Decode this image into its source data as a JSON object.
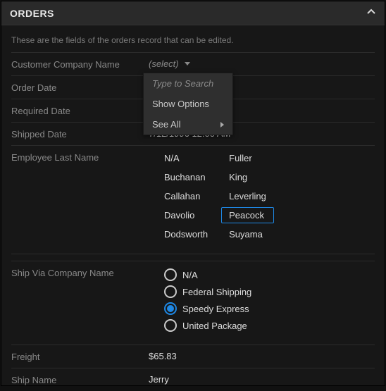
{
  "header": {
    "title": "ORDERS"
  },
  "intro": "These are the fields of the orders record that can be edited.",
  "fields": {
    "customer": {
      "label": "Customer Company Name",
      "placeholder": "(select)",
      "dropdown": {
        "hint": "Type to Search",
        "show_options": "Show Options",
        "see_all": "See All"
      }
    },
    "order_date": {
      "label": "Order Date",
      "value": ""
    },
    "required_date": {
      "label": "Required Date",
      "value": ""
    },
    "shipped_date": {
      "label": "Shipped Date",
      "value": "7/12/1996 12:00 AM"
    },
    "employee": {
      "label": "Employee Last Name",
      "col1": [
        "N/A",
        "Buchanan",
        "Callahan",
        "Davolio",
        "Dodsworth"
      ],
      "col2": [
        "Fuller",
        "King",
        "Leverling",
        "Peacock",
        "Suyama"
      ],
      "selected": "Peacock"
    },
    "shipvia": {
      "label": "Ship Via Company Name",
      "options": [
        "N/A",
        "Federal Shipping",
        "Speedy Express",
        "United Package"
      ],
      "selected": "Speedy Express"
    },
    "freight": {
      "label": "Freight",
      "value": "$65.83"
    },
    "ship_name": {
      "label": "Ship Name",
      "value": "Jerry"
    }
  }
}
